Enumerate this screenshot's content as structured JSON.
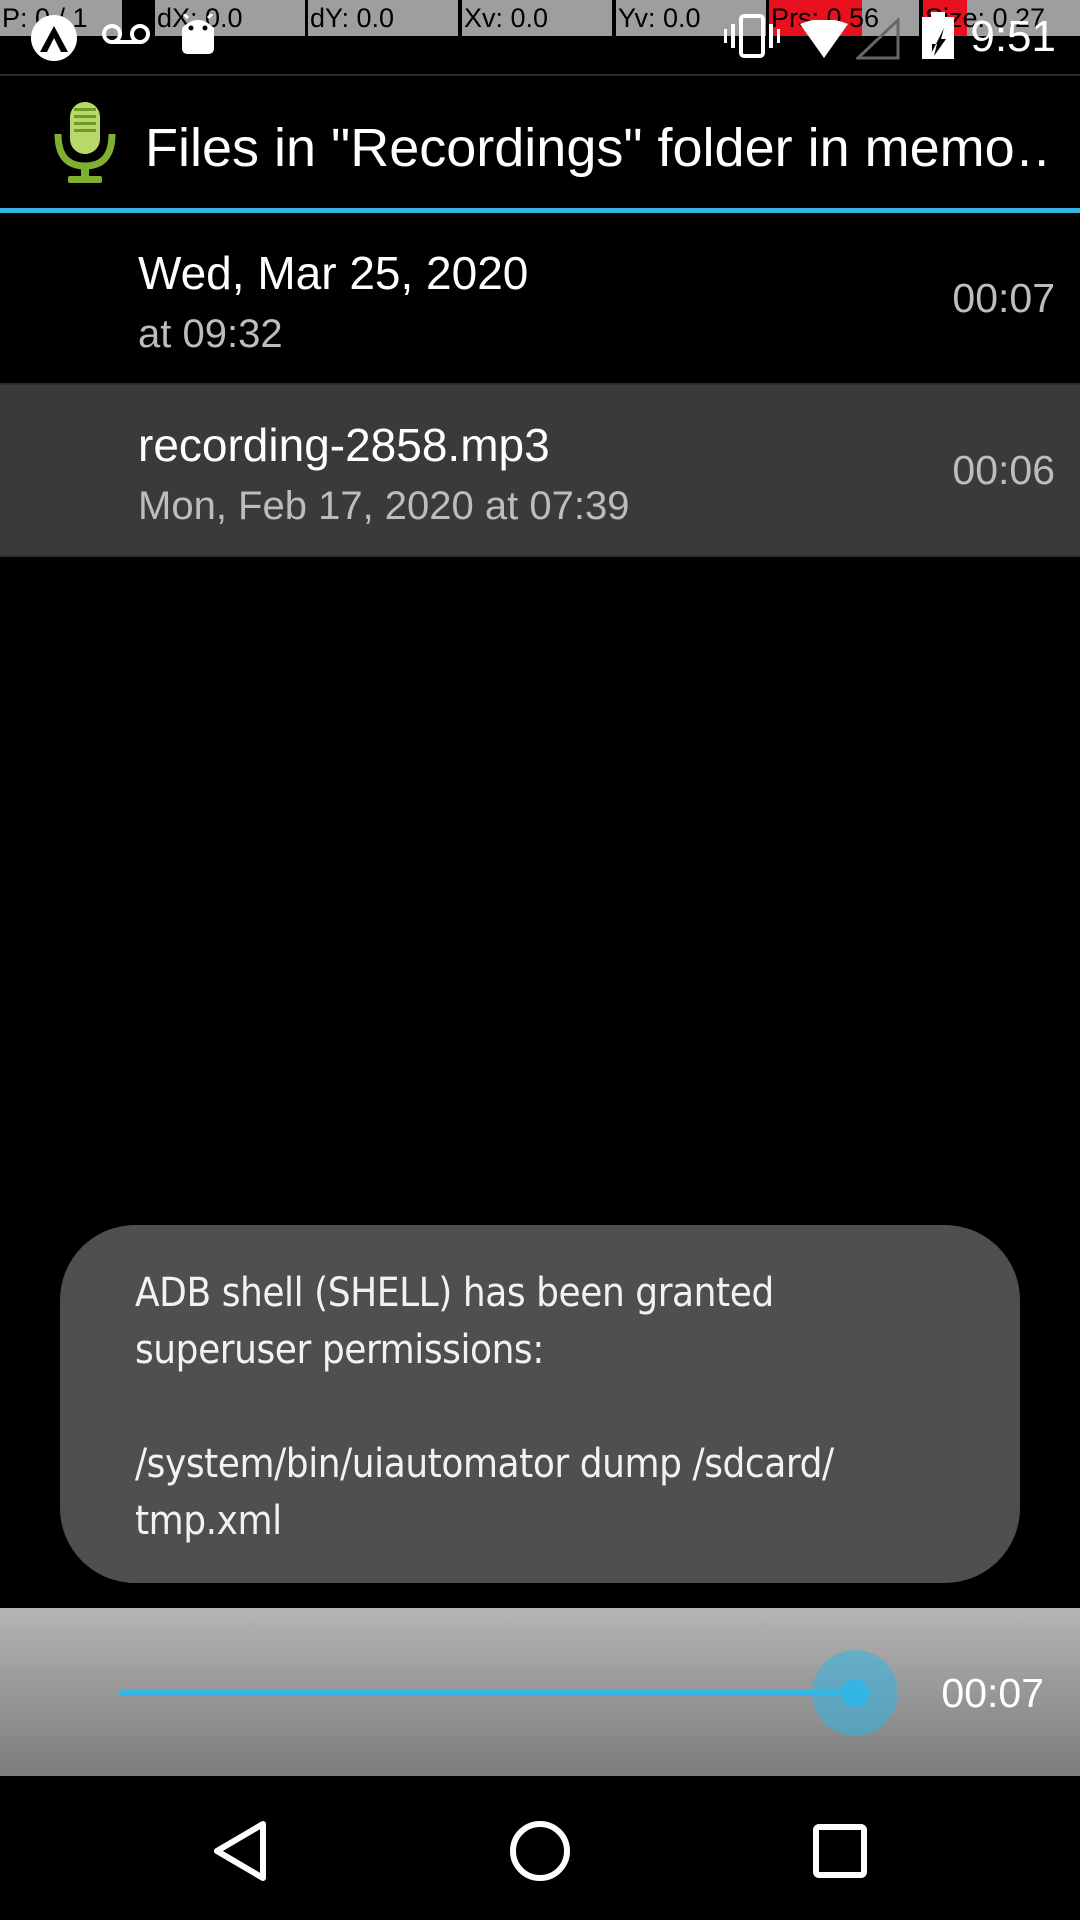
{
  "debug_overlay": {
    "pointer": "P: 0 / 1",
    "dx": "dX: 0.0",
    "dy": "dY: 0.0",
    "xv": "Xv: 0.0",
    "yv": "Yv: 0.0",
    "prs": "Prs: 0.56",
    "size": "Size: 0.27"
  },
  "status_bar": {
    "time": "9:51",
    "left_icons": [
      "app-notification-icon",
      "voicemail-icon",
      "android-icon"
    ],
    "right_icons": [
      "vibrate-icon",
      "wifi-icon",
      "no-signal-icon",
      "battery-icon"
    ]
  },
  "action_bar": {
    "icon": "microphone-icon",
    "title": "Files in \"Recordings\" folder in memo…"
  },
  "recordings": [
    {
      "title": "Wed, Mar 25, 2020",
      "subtitle": "at 09:32",
      "duration": "00:07",
      "selected": false
    },
    {
      "title": "recording-2858.mp3",
      "subtitle": "Mon, Feb 17, 2020 at 07:39",
      "duration": "00:06",
      "selected": true
    }
  ],
  "toast": {
    "line1": "ADB shell (SHELL) has been granted",
    "line2": "superuser permissions:",
    "line3": "/system/bin/uiautomator dump /sdcard/",
    "line4": "tmp.xml"
  },
  "playback": {
    "time": "00:07",
    "progress": 1.0
  },
  "nav_bar": {
    "buttons": [
      "back-icon",
      "home-icon",
      "recents-icon"
    ]
  },
  "colors": {
    "accent": "#33b5e5",
    "background": "#000000",
    "toast_bg": "#4f4f4f",
    "selected_row": "#3a3a3a",
    "highlight_red": "#e8101e"
  }
}
